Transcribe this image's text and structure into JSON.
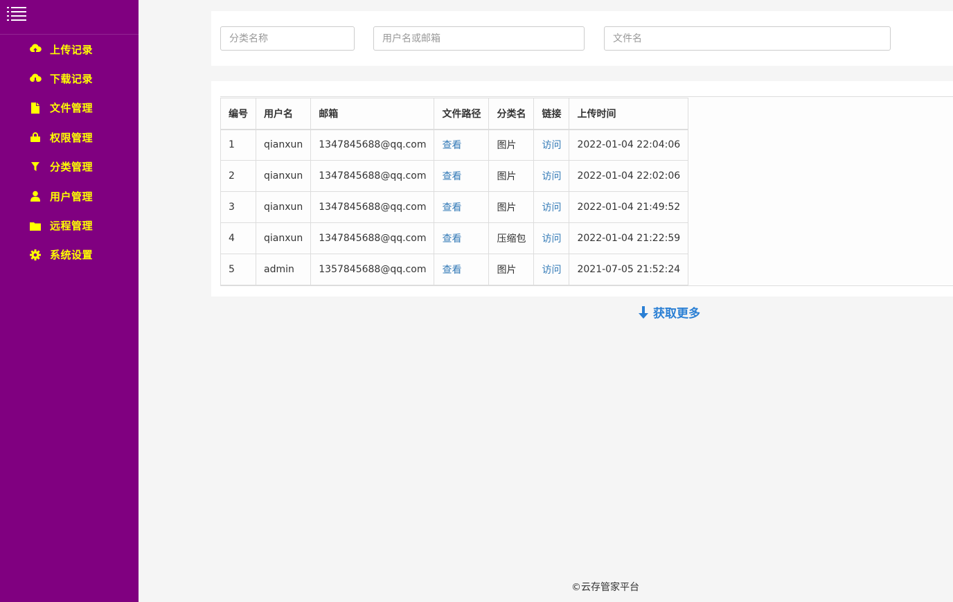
{
  "sidebar": {
    "items": [
      {
        "label": "上传记录",
        "icon": "cloud-upload-icon"
      },
      {
        "label": "下载记录",
        "icon": "cloud-download-icon"
      },
      {
        "label": "文件管理",
        "icon": "file-icon"
      },
      {
        "label": "权限管理",
        "icon": "lock-icon"
      },
      {
        "label": "分类管理",
        "icon": "filter-icon"
      },
      {
        "label": "用户管理",
        "icon": "user-icon"
      },
      {
        "label": "远程管理",
        "icon": "folder-icon"
      },
      {
        "label": "系统设置",
        "icon": "gear-icon"
      }
    ]
  },
  "filters": {
    "category_placeholder": "分类名称",
    "user_placeholder": "用户名或邮箱",
    "filename_placeholder": "文件名"
  },
  "table": {
    "headers": [
      "编号",
      "用户名",
      "邮箱",
      "文件路径",
      "分类名",
      "链接",
      "上传时间"
    ],
    "rows": [
      {
        "id": "1",
        "username": "qianxun",
        "email": "1347845688@qq.com",
        "path": "查看",
        "category": "图片",
        "link": "访问",
        "time": "2022-01-04 22:04:06"
      },
      {
        "id": "2",
        "username": "qianxun",
        "email": "1347845688@qq.com",
        "path": "查看",
        "category": "图片",
        "link": "访问",
        "time": "2022-01-04 22:02:06"
      },
      {
        "id": "3",
        "username": "qianxun",
        "email": "1347845688@qq.com",
        "path": "查看",
        "category": "图片",
        "link": "访问",
        "time": "2022-01-04 21:49:52"
      },
      {
        "id": "4",
        "username": "qianxun",
        "email": "1347845688@qq.com",
        "path": "查看",
        "category": "压缩包",
        "link": "访问",
        "time": "2022-01-04 21:22:59"
      },
      {
        "id": "5",
        "username": "admin",
        "email": "1357845688@qq.com",
        "path": "查看",
        "category": "图片",
        "link": "访问",
        "time": "2021-07-05 21:52:24"
      }
    ]
  },
  "load_more": "获取更多",
  "footer": "©云存管家平台",
  "colors": {
    "sidebar_bg": "#800080",
    "sidebar_text": "#ffff00",
    "link": "#337ab7",
    "load_more": "#2a7fd4"
  }
}
